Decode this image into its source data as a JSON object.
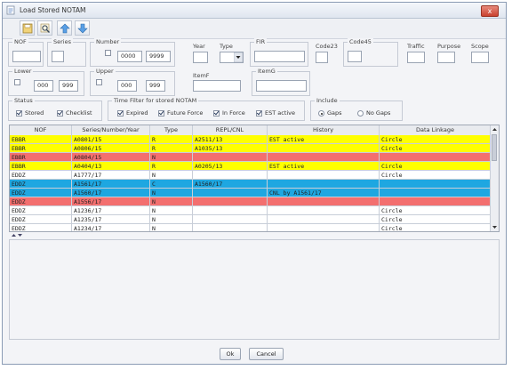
{
  "window": {
    "title": "Load Stored NOTAM",
    "close_label": "x"
  },
  "toolbar": {
    "icons": [
      "save-icon",
      "search-icon",
      "move-up-icon",
      "move-down-icon"
    ]
  },
  "filters": {
    "nof": {
      "label": "NOF",
      "value": ""
    },
    "series": {
      "label": "Series",
      "value": ""
    },
    "number": {
      "label": "Number",
      "from": "0000",
      "to": "9999"
    },
    "year": {
      "label": "Year",
      "value": ""
    },
    "type": {
      "label": "Type",
      "value": ""
    },
    "fir": {
      "label": "FIR",
      "value": ""
    },
    "code23": {
      "label": "Code23",
      "value": ""
    },
    "code45": {
      "label": "Code45",
      "value": ""
    },
    "traffic": {
      "label": "Traffic",
      "value": ""
    },
    "purpose": {
      "label": "Purpose",
      "value": ""
    },
    "scope": {
      "label": "Scope",
      "value": ""
    },
    "lower": {
      "label": "Lower",
      "from": "000",
      "to": "999"
    },
    "upper": {
      "label": "Upper",
      "from": "000",
      "to": "999"
    },
    "itemf": {
      "label": "ItemF",
      "value": ""
    },
    "itemg": {
      "label": "ItemG",
      "value": ""
    }
  },
  "status": {
    "label": "Status",
    "stored": "Stored",
    "checklist": "Checklist"
  },
  "time_filter": {
    "label": "Time Filter for stored NOTAM",
    "expired": "Expired",
    "future_force": "Future Force",
    "in_force": "In Force",
    "est_active": "EST active"
  },
  "include": {
    "label": "Include",
    "gaps": "Gaps",
    "no_gaps": "No Gaps",
    "selected": "Gaps"
  },
  "table": {
    "columns": [
      "NOF",
      "Series/Number/Year",
      "Type",
      "REPL/CNL",
      "History",
      "Data Linkage"
    ],
    "rows": [
      {
        "nof": "EBBR",
        "snum": "A0801/15",
        "type": "R",
        "repl": "A2511/13",
        "history": "EST active",
        "linkage": "Circle",
        "color": "#ffff00"
      },
      {
        "nof": "EBBR",
        "snum": "A0806/15",
        "type": "R",
        "repl": "A1035/13",
        "history": "",
        "linkage": "Circle",
        "color": "#ffff00"
      },
      {
        "nof": "EBBR",
        "snum": "A0804/15",
        "type": "N",
        "repl": "",
        "history": "",
        "linkage": "",
        "color": "#f36f6f"
      },
      {
        "nof": "EBBR",
        "snum": "A0404/13",
        "type": "R",
        "repl": "A0205/13",
        "history": "EST active",
        "linkage": "Circle",
        "color": "#ffff00"
      },
      {
        "nof": "EDDZ",
        "snum": "A1777/17",
        "type": "N",
        "repl": "",
        "history": "",
        "linkage": "Circle",
        "color": "#ffffff"
      },
      {
        "nof": "EDDZ",
        "snum": "A1561/17",
        "type": "C",
        "repl": "A1560/17",
        "history": "",
        "linkage": "",
        "color": "#1ea7e1"
      },
      {
        "nof": "EDDZ",
        "snum": "A1560/17",
        "type": "N",
        "repl": "",
        "history": "CNL by A1561/17",
        "linkage": "",
        "color": "#1ea7e1"
      },
      {
        "nof": "EDDZ",
        "snum": "A1556/17",
        "type": "N",
        "repl": "",
        "history": "",
        "linkage": "",
        "color": "#f36f6f"
      },
      {
        "nof": "EDDZ",
        "snum": "A1236/17",
        "type": "N",
        "repl": "",
        "history": "",
        "linkage": "Circle",
        "color": "#ffffff"
      },
      {
        "nof": "EDDZ",
        "snum": "A1235/17",
        "type": "N",
        "repl": "",
        "history": "",
        "linkage": "Circle",
        "color": "#ffffff"
      },
      {
        "nof": "EDDZ",
        "snum": "A1234/17",
        "type": "N",
        "repl": "",
        "history": "",
        "linkage": "Circle",
        "color": "#ffffff"
      }
    ]
  },
  "buttons": {
    "ok": "Ok",
    "cancel": "Cancel"
  }
}
